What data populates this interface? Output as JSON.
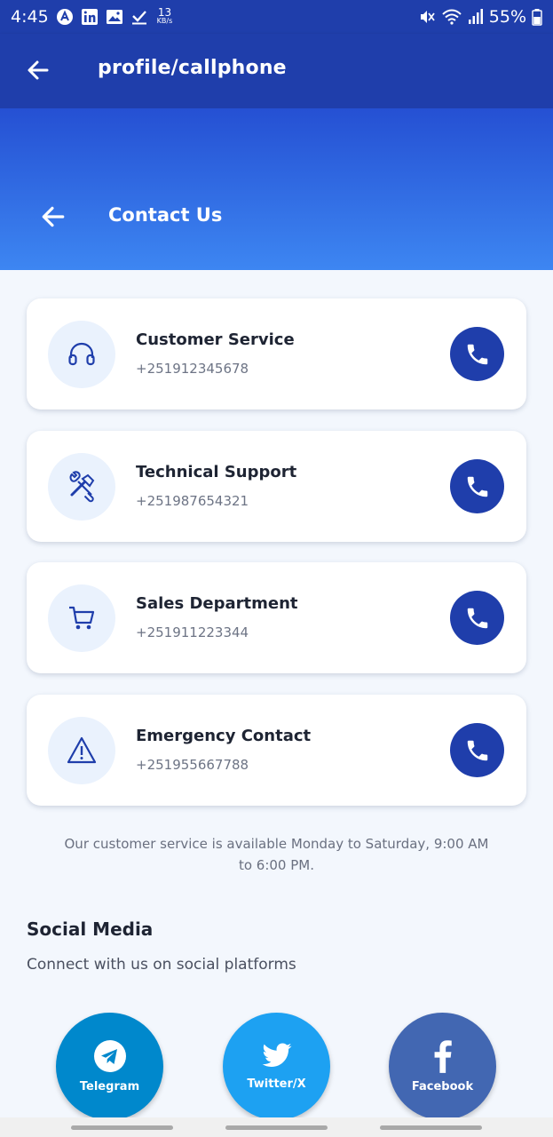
{
  "status_bar": {
    "time": "4:45",
    "kbs_value": "13",
    "kbs_unit": "KB/s",
    "battery": "55%",
    "left_icons": [
      "notification-a-icon",
      "linkedin-icon",
      "gallery-icon",
      "checkmark-icon"
    ],
    "right_icons": [
      "mute-icon",
      "wifi-icon",
      "signal-icon",
      "battery-icon"
    ]
  },
  "app_bar": {
    "title": "profile/callphone"
  },
  "header": {
    "title": "Contact Us"
  },
  "contacts": [
    {
      "title": "Customer Service",
      "phone": "+251912345678",
      "icon": "headphones-icon"
    },
    {
      "title": "Technical Support",
      "phone": "+251987654321",
      "icon": "tools-icon"
    },
    {
      "title": "Sales Department",
      "phone": "+251911223344",
      "icon": "cart-icon"
    },
    {
      "title": "Emergency Contact",
      "phone": "+251955667788",
      "icon": "warning-icon"
    }
  ],
  "hours_note": "Our customer service is available Monday to Saturday, 9:00 AM to 6:00 PM.",
  "social": {
    "title": "Social Media",
    "subtitle": "Connect with us on social platforms",
    "buttons": [
      {
        "label": "Telegram",
        "icon": "telegram-icon",
        "color": "#0088cc"
      },
      {
        "label": "Twitter/X",
        "icon": "twitter-icon",
        "color": "#1da1f2"
      },
      {
        "label": "Facebook",
        "icon": "facebook-icon",
        "color": "#4267b2"
      }
    ]
  },
  "colors": {
    "primary": "#1f3eab",
    "gradient_top": "#2550d3",
    "gradient_bottom": "#3d86f2",
    "background": "#f3f7fd",
    "icon_bg": "#eaf2fd"
  }
}
